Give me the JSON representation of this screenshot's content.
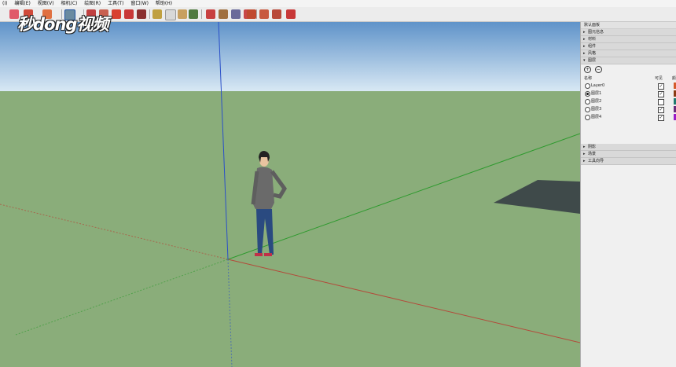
{
  "menu": [
    "(I)",
    "编辑(E)",
    "视图(V)",
    "相机(C)",
    "绘图(R)",
    "工具(T)",
    "窗口(W)",
    "帮助(H)"
  ],
  "watermark": "秒dong视频",
  "panel": {
    "title": "默认面板",
    "sections_top": [
      "图元信息",
      "材料",
      "组件",
      "风格",
      "图层"
    ],
    "layers_header": {
      "name": "名称",
      "visible": "可见",
      "color": "颜"
    },
    "layers": [
      {
        "name": "Layer0",
        "active": false,
        "visible": true,
        "color": "#d45a2a"
      },
      {
        "name": "图层1",
        "active": true,
        "visible": true,
        "color": "#8a3a12"
      },
      {
        "name": "图层2",
        "active": false,
        "visible": false,
        "color": "#1f7a6e"
      },
      {
        "name": "图层3",
        "active": false,
        "visible": true,
        "color": "#6a2a7a"
      },
      {
        "name": "图层4",
        "active": false,
        "visible": true,
        "color": "#9a1ac8"
      }
    ],
    "sections_bottom": [
      "阴影",
      "场景",
      "工具向导"
    ]
  },
  "colors": {
    "sky_top": "#5f93c9",
    "sky_bottom": "#d8e8f4",
    "ground": "#8aad7a",
    "axis_red": "#b34a3a",
    "axis_green": "#2e9a2e",
    "axis_blue": "#2a4fc8",
    "rectangle": "#3f4a4a"
  }
}
